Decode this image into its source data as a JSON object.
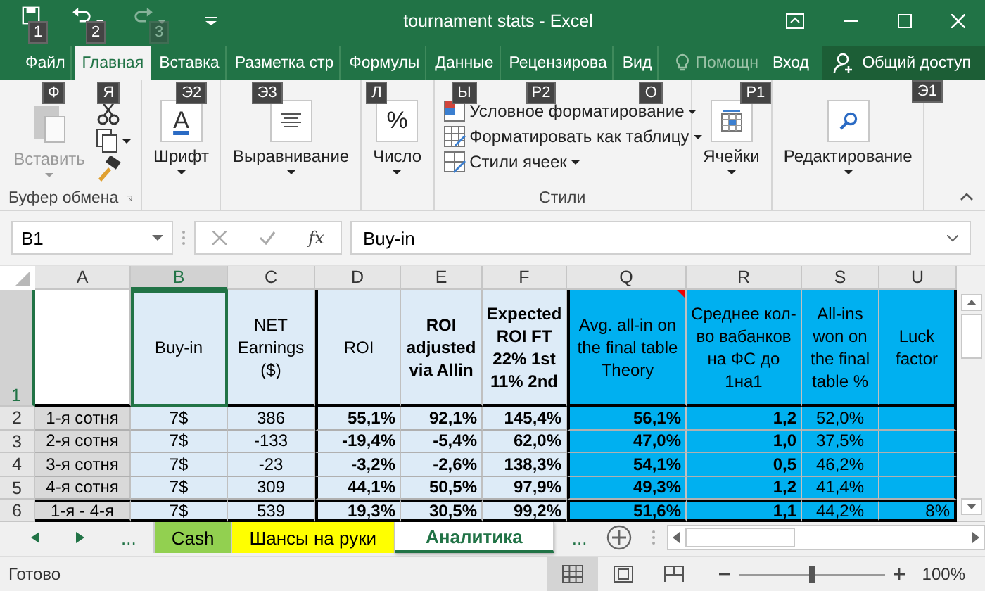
{
  "window": {
    "title": "tournament stats - Excel"
  },
  "quick_access": [
    {
      "kind": "save",
      "keytip": "1",
      "disabled": false
    },
    {
      "kind": "undo",
      "keytip": "2",
      "disabled": false
    },
    {
      "kind": "redo",
      "keytip": "3",
      "disabled": true
    }
  ],
  "ribbon_tabs": [
    {
      "label": "Файл",
      "keytip": "Ф",
      "selected": false
    },
    {
      "label": "Главная",
      "keytip": "Я",
      "selected": true
    },
    {
      "label": "Вставка",
      "keytip": "Э2",
      "selected": false
    },
    {
      "label": "Разметка стр",
      "keytip": "Э3",
      "selected": false
    },
    {
      "label": "Формулы",
      "keytip": "Л",
      "selected": false
    },
    {
      "label": "Данные",
      "keytip": "Ы",
      "selected": false
    },
    {
      "label": "Рецензирова",
      "keytip": "Р2",
      "selected": false
    },
    {
      "label": "Вид",
      "keytip": "О",
      "selected": false
    }
  ],
  "tell_me": {
    "placeholder": "Помощн",
    "keytip": "Р1"
  },
  "sign_in": "Вход",
  "share": {
    "label": "Общий доступ",
    "keytip": "Э1"
  },
  "ribbon": {
    "groups": [
      {
        "kind": "clipboard",
        "label": "Буфер обмена",
        "paste": {
          "label": "Вставить",
          "disabled": true
        }
      },
      {
        "kind": "font",
        "label": "Шрифт",
        "glyph": "A"
      },
      {
        "kind": "alignment",
        "label": "Выравнивание"
      },
      {
        "kind": "number",
        "label": "Число",
        "glyph": "%"
      },
      {
        "kind": "styles",
        "label": "Стили",
        "commands": [
          "Условное форматирование",
          "Форматировать как таблицу",
          "Стили ячеек"
        ]
      },
      {
        "kind": "cells",
        "label": "Ячейки"
      },
      {
        "kind": "editing",
        "label": "Редактирование"
      }
    ]
  },
  "formula_bar": {
    "name_box": "B1",
    "function_label": "fx",
    "value": "Buy-in"
  },
  "sheet": {
    "columns": [
      {
        "letter": "A",
        "selected": false,
        "color": "#d9d9d9",
        "bold": false
      },
      {
        "letter": "B",
        "selected": true,
        "color": "#ddebf7",
        "bold": false,
        "header": {
          "text": "Buy-in",
          "bold": false
        }
      },
      {
        "letter": "C",
        "selected": false,
        "color": "#ddebf7",
        "bold": false,
        "header": {
          "text": "NET Earnings ($)",
          "bold": false
        }
      },
      {
        "letter": "D",
        "selected": false,
        "color": "#ddebf7",
        "bold": true,
        "header": {
          "text": "ROI",
          "bold": false
        }
      },
      {
        "letter": "E",
        "selected": false,
        "color": "#ddebf7",
        "bold": true,
        "header": {
          "text": "ROI adjusted via Allin",
          "bold": true
        }
      },
      {
        "letter": "F",
        "selected": false,
        "color": "#ddebf7",
        "bold": true,
        "header": {
          "text": "Expected ROI FT 22% 1st 11% 2nd",
          "bold": true
        }
      },
      {
        "letter": "Q",
        "selected": false,
        "color": "#00b0f0",
        "bold": true,
        "header": {
          "text": "Avg. all-in on the final table Theory",
          "bold": false,
          "comment": true
        }
      },
      {
        "letter": "R",
        "selected": false,
        "color": "#00b0f0",
        "bold": true,
        "header": {
          "text": "Среднее кол-во вабанков на ФС до 1на1",
          "bold": false
        }
      },
      {
        "letter": "S",
        "selected": false,
        "color": "#00b0f0",
        "bold": false,
        "header": {
          "text": "All-ins won on the final table %",
          "bold": false
        }
      },
      {
        "letter": "U",
        "selected": false,
        "color": "#00b0f0",
        "bold": false,
        "header": {
          "text": "Luck factor",
          "bold": false
        }
      }
    ],
    "header_row": {
      "number": "1",
      "selected": true
    },
    "rows": [
      {
        "number": "2",
        "kind": "data",
        "cells": [
          "1-я сотня",
          "7$",
          "386",
          "55,1%",
          "92,1%",
          "145,4%",
          "56,1%",
          "1,2",
          "52,0%",
          null
        ]
      },
      {
        "number": "3",
        "kind": "data",
        "cells": [
          "2-я сотня",
          "7$",
          "-133",
          "-19,4%",
          "-5,4%",
          "62,0%",
          "47,0%",
          "1,0",
          "37,5%",
          null
        ]
      },
      {
        "number": "4",
        "kind": "data",
        "cells": [
          "3-я сотня",
          "7$",
          "-23",
          "-3,2%",
          "-2,6%",
          "138,3%",
          "54,1%",
          "0,5",
          "46,2%",
          null
        ]
      },
      {
        "number": "5",
        "kind": "data",
        "cells": [
          "4-я сотня",
          "7$",
          "309",
          "44,1%",
          "50,5%",
          "97,9%",
          "49,3%",
          "1,2",
          "41,4%",
          null
        ]
      },
      {
        "number": "6",
        "kind": "total",
        "cells": [
          "1-я - 4-я",
          "7$",
          "539",
          "19,3%",
          "30,5%",
          "99,2%",
          "51,6%",
          "1,1",
          "44,2%",
          "8%"
        ]
      }
    ]
  },
  "sheet_tabs": {
    "more_left": "...",
    "more_right": "...",
    "tabs": [
      {
        "label": "Cash",
        "color": "#92d050",
        "selected": false
      },
      {
        "label": "Шансы на руки",
        "color": "#ffff00",
        "selected": false
      },
      {
        "label": "Аналитика",
        "color": "#ffffff",
        "selected": true
      }
    ]
  },
  "status_bar": {
    "status": "Готово",
    "views": [
      {
        "kind": "normal",
        "selected": true
      },
      {
        "kind": "page_layout",
        "selected": false
      },
      {
        "kind": "page_break",
        "selected": false
      }
    ],
    "zoom": {
      "level": 0.5,
      "reading": "100%"
    }
  }
}
